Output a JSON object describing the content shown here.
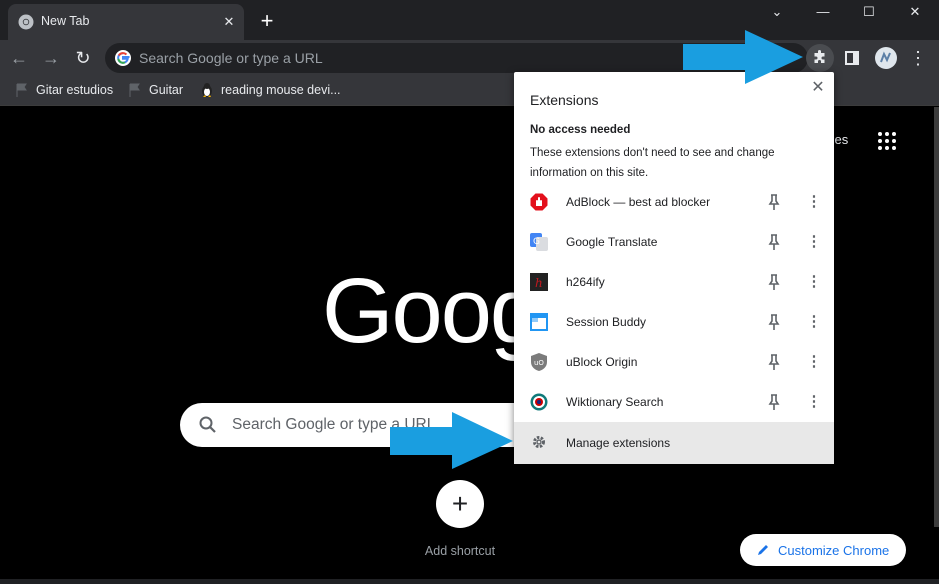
{
  "tab": {
    "title": "New Tab",
    "close": "✕"
  },
  "tabstrip": {
    "new_tab": "+",
    "minimize": "—",
    "maximize": "☐",
    "close": "✕",
    "dropdown": "⌄"
  },
  "toolbar": {
    "back": "←",
    "forward": "→",
    "reload": "↻",
    "menu": "⋮"
  },
  "omnibox": {
    "placeholder": "Search Google or type a URL"
  },
  "bookmarks": [
    {
      "label": "Gitar estudios"
    },
    {
      "label": "Guitar"
    },
    {
      "label": "reading mouse devi..."
    }
  ],
  "ntp": {
    "images_link": "ages",
    "logo": "Goog",
    "search_placeholder": "Search Google or type a URL",
    "add_shortcut_label": "Add shortcut",
    "add_shortcut_icon": "+",
    "customize_label": "Customize Chrome"
  },
  "extensions_popup": {
    "title": "Extensions",
    "close": "✕",
    "section_heading": "No access needed",
    "section_description": "These extensions don't need to see and change information on this site.",
    "items": [
      {
        "name": "AdBlock — best ad blocker",
        "icon": "adblock-icon",
        "color": "#e3101c"
      },
      {
        "name": "Google Translate",
        "icon": "google-translate-icon",
        "color": "#4285f4"
      },
      {
        "name": "h264ify",
        "icon": "h264ify-icon",
        "color": "#c4191f"
      },
      {
        "name": "Session Buddy",
        "icon": "session-buddy-icon",
        "color": "#2196f3"
      },
      {
        "name": "uBlock Origin",
        "icon": "ublock-origin-icon",
        "color": "#800000"
      },
      {
        "name": "Wiktionary Search",
        "icon": "wiktionary-icon",
        "color": "#cc0000"
      }
    ],
    "more_glyph": "⋮",
    "manage_label": "Manage extensions"
  },
  "colors": {
    "accent_arrow": "#1a9ee0",
    "link_blue": "#1a73e8"
  }
}
